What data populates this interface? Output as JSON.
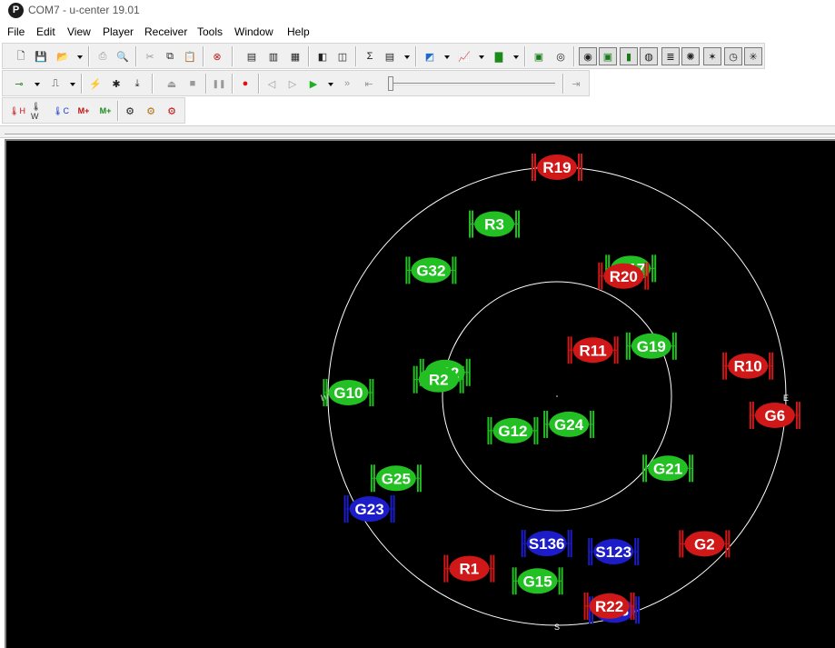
{
  "window": {
    "title": "COM7 - u-center 19.01",
    "logo_letter": "P"
  },
  "menu": [
    "File",
    "Edit",
    "View",
    "Player",
    "Receiver",
    "Tools",
    "Window",
    "Help"
  ],
  "toolbar1": {
    "buttons": [
      {
        "icon": "new-file-icon",
        "glyph": "🗋"
      },
      {
        "icon": "save-icon",
        "glyph": "💾"
      },
      {
        "icon": "open-icon",
        "glyph": "📂"
      },
      {
        "icon": "print-icon",
        "glyph": "⎙"
      },
      {
        "icon": "print-preview-icon",
        "glyph": "🔍"
      },
      {
        "icon": "cut-icon",
        "glyph": "✂"
      },
      {
        "icon": "copy-icon",
        "glyph": "⧉"
      },
      {
        "icon": "paste-icon",
        "glyph": "📋"
      },
      {
        "icon": "clear-icon",
        "glyph": "⊗"
      },
      {
        "icon": "export-icon",
        "glyph": "▤"
      },
      {
        "icon": "export-kml-icon",
        "glyph": "▥"
      },
      {
        "icon": "export-csv-icon",
        "glyph": "▦"
      },
      {
        "icon": "docking-icon",
        "glyph": "◧"
      },
      {
        "icon": "layout-icon",
        "glyph": "◫"
      },
      {
        "icon": "statistics-icon",
        "glyph": "Σ"
      },
      {
        "icon": "table-view-icon",
        "glyph": "▤"
      },
      {
        "icon": "map-view-icon",
        "glyph": "◩"
      },
      {
        "icon": "chart-view-icon",
        "glyph": "📈"
      },
      {
        "icon": "histogram-icon",
        "glyph": "▇"
      },
      {
        "icon": "camera-icon",
        "glyph": "▣"
      },
      {
        "icon": "satellite-sky-icon",
        "glyph": "◎"
      },
      {
        "icon": "deviation-map-icon",
        "glyph": "◉"
      },
      {
        "icon": "sky-view-icon",
        "glyph": "▣"
      },
      {
        "icon": "signal-bars-icon",
        "glyph": "▮"
      },
      {
        "icon": "world-icon",
        "glyph": "◍"
      },
      {
        "icon": "data-view-icon",
        "glyph": "≣"
      },
      {
        "icon": "compass-icon",
        "glyph": "✺"
      },
      {
        "icon": "rose-icon",
        "glyph": "✶"
      },
      {
        "icon": "clock-icon",
        "glyph": "◷"
      },
      {
        "icon": "gauge-icon",
        "glyph": "✳"
      }
    ]
  },
  "toolbar2": {
    "buttons": [
      {
        "icon": "connection-icon",
        "glyph": "⊸"
      },
      {
        "icon": "baudrate-icon",
        "glyph": "⎍"
      },
      {
        "icon": "autobaud-icon",
        "glyph": "⚡"
      },
      {
        "icon": "debug-icon",
        "glyph": "✱"
      },
      {
        "icon": "download-icon",
        "glyph": "⤓"
      },
      {
        "icon": "eject-icon",
        "glyph": "⏏"
      },
      {
        "icon": "stop-icon",
        "glyph": "■"
      },
      {
        "icon": "pause-icon",
        "glyph": "❚❚"
      },
      {
        "icon": "record-icon",
        "glyph": "●"
      },
      {
        "icon": "step-back-icon",
        "glyph": "◁"
      },
      {
        "icon": "step-forward-icon",
        "glyph": "▷"
      },
      {
        "icon": "play-icon",
        "glyph": "▶"
      },
      {
        "icon": "fast-forward-icon",
        "glyph": "»"
      },
      {
        "icon": "rewind-icon",
        "glyph": "⇤"
      },
      {
        "icon": "jump-end-icon",
        "glyph": "⇥"
      }
    ]
  },
  "toolbar3": {
    "buttons": [
      {
        "icon": "hot-start-icon",
        "glyph": "🌡H"
      },
      {
        "icon": "warm-start-icon",
        "glyph": "🌡W"
      },
      {
        "icon": "cold-start-icon",
        "glyph": "🌡C"
      },
      {
        "icon": "message-add-icon",
        "glyph": "M+"
      },
      {
        "icon": "message-plus-icon",
        "glyph": "M+"
      },
      {
        "icon": "config-gear-icon",
        "glyph": "⚙"
      },
      {
        "icon": "config-gear-2-icon",
        "glyph": "⚙"
      },
      {
        "icon": "config-gear-3-icon",
        "glyph": "⚙"
      }
    ]
  },
  "sky_view": {
    "compass": {
      "north": "",
      "east": "E",
      "south": "S",
      "west": "W"
    },
    "colors": {
      "gps": "#22c022",
      "glonass": "#d01818",
      "sbas": "#1c1cc8",
      "ring": "#ffffff",
      "background": "#000000"
    },
    "satellites": [
      {
        "id": "R19",
        "system": "glonass",
        "azimuth": 0,
        "elevation": 0
      },
      {
        "id": "R3",
        "system": "gps",
        "azimuth": 340,
        "elevation": 18
      },
      {
        "id": "G32",
        "system": "gps",
        "azimuth": 315,
        "elevation": 20
      },
      {
        "id": "G17",
        "system": "gps",
        "azimuth": 30,
        "elevation": 32
      },
      {
        "id": "R20",
        "system": "glonass",
        "azimuth": 29,
        "elevation": 36
      },
      {
        "id": "R11",
        "system": "glonass",
        "azimuth": 38,
        "elevation": 67
      },
      {
        "id": "G19",
        "system": "gps",
        "azimuth": 62,
        "elevation": 48
      },
      {
        "id": "R10",
        "system": "glonass",
        "azimuth": 81,
        "elevation": 14
      },
      {
        "id": "G6",
        "system": "glonass",
        "azimuth": 95,
        "elevation": 4
      },
      {
        "id": "R12",
        "system": "gps",
        "azimuth": 282,
        "elevation": 45
      },
      {
        "id": "R2",
        "system": "gps",
        "azimuth": 278,
        "elevation": 43
      },
      {
        "id": "G10",
        "system": "gps",
        "azimuth": 271,
        "elevation": 8
      },
      {
        "id": "G12",
        "system": "gps",
        "azimuth": 232,
        "elevation": 68
      },
      {
        "id": "G24",
        "system": "gps",
        "azimuth": 157,
        "elevation": 78
      },
      {
        "id": "G25",
        "system": "gps",
        "azimuth": 243,
        "elevation": 19
      },
      {
        "id": "G21",
        "system": "gps",
        "azimuth": 123,
        "elevation": 38
      },
      {
        "id": "G23",
        "system": "sbas",
        "azimuth": 239,
        "elevation": 4
      },
      {
        "id": "R1",
        "system": "glonass",
        "azimuth": 207,
        "elevation": 14
      },
      {
        "id": "S136",
        "system": "sbas",
        "azimuth": 184,
        "elevation": 32
      },
      {
        "id": "S123",
        "system": "sbas",
        "azimuth": 160,
        "elevation": 25
      },
      {
        "id": "G2",
        "system": "glonass",
        "azimuth": 135,
        "elevation": 8
      },
      {
        "id": "G15",
        "system": "gps",
        "azimuth": 186,
        "elevation": 17
      },
      {
        "id": "G13",
        "system": "sbas",
        "azimuth": 165,
        "elevation": 3
      },
      {
        "id": "R22",
        "system": "glonass",
        "azimuth": 166,
        "elevation": 5
      }
    ]
  }
}
